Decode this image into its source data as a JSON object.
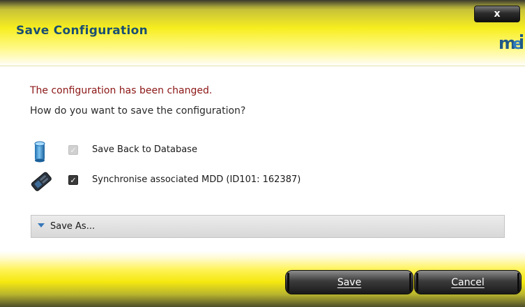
{
  "dialog": {
    "title": "Save Configuration",
    "close_label": "x",
    "logo_text": "mei"
  },
  "message": {
    "changed": "The configuration has been changed.",
    "question": "How do you want to save the configuration?"
  },
  "options": [
    {
      "label": "Save Back to Database",
      "checked": true,
      "enabled": false,
      "icon": "database-icon"
    },
    {
      "label": "Synchronise associated MDD (ID101: 162387)",
      "checked": true,
      "enabled": true,
      "icon": "mdd-device-icon"
    }
  ],
  "save_as": {
    "label": "Save As...",
    "expanded": false
  },
  "buttons": {
    "save": "Save",
    "cancel": "Cancel"
  },
  "colors": {
    "accent_yellow": "#f7ee1f",
    "title_blue": "#1b4f73",
    "warning_red": "#8c1515"
  }
}
